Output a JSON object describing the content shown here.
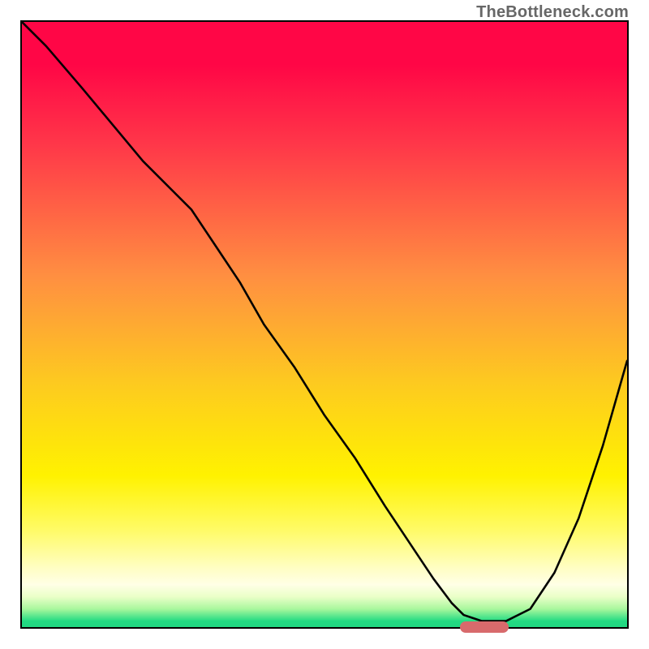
{
  "watermark": "TheBottleneck.com",
  "chart_data": {
    "type": "line",
    "title": "",
    "xlabel": "",
    "ylabel": "",
    "xlim": [
      0,
      100
    ],
    "ylim": [
      0,
      100
    ],
    "grid": false,
    "legend": false,
    "x": [
      0,
      4,
      10,
      15,
      20,
      25,
      28,
      32,
      36,
      40,
      45,
      50,
      55,
      60,
      64,
      68,
      71,
      73,
      76,
      80,
      84,
      88,
      92,
      96,
      100
    ],
    "y": [
      100,
      96,
      89,
      83,
      77,
      72,
      69,
      63,
      57,
      50,
      43,
      35,
      28,
      20,
      14,
      8,
      4,
      2,
      1,
      1,
      3,
      9,
      18,
      30,
      44
    ],
    "series": [
      {
        "name": "bottleneck-curve",
        "x_ref": "x",
        "y_ref": "y",
        "stroke": "#000000",
        "width": 2
      }
    ],
    "marker": {
      "name": "sweet-spot",
      "x_start": 72,
      "x_end": 80,
      "y": 0,
      "color": "#d86a6c"
    },
    "background_gradient": {
      "stops": [
        {
          "pos": 0,
          "color": "#ff0646"
        },
        {
          "pos": 7,
          "color": "#ff0646"
        },
        {
          "pos": 20,
          "color": "#ff3649"
        },
        {
          "pos": 42,
          "color": "#ff8f41"
        },
        {
          "pos": 60,
          "color": "#fdcb1f"
        },
        {
          "pos": 75,
          "color": "#fff200"
        },
        {
          "pos": 84,
          "color": "#fffb67"
        },
        {
          "pos": 90,
          "color": "#fffec0"
        },
        {
          "pos": 93,
          "color": "#ffffe6"
        },
        {
          "pos": 95,
          "color": "#eaffc8"
        },
        {
          "pos": 97,
          "color": "#a9f79d"
        },
        {
          "pos": 99,
          "color": "#23db83"
        },
        {
          "pos": 100,
          "color": "#21d681"
        }
      ]
    }
  }
}
